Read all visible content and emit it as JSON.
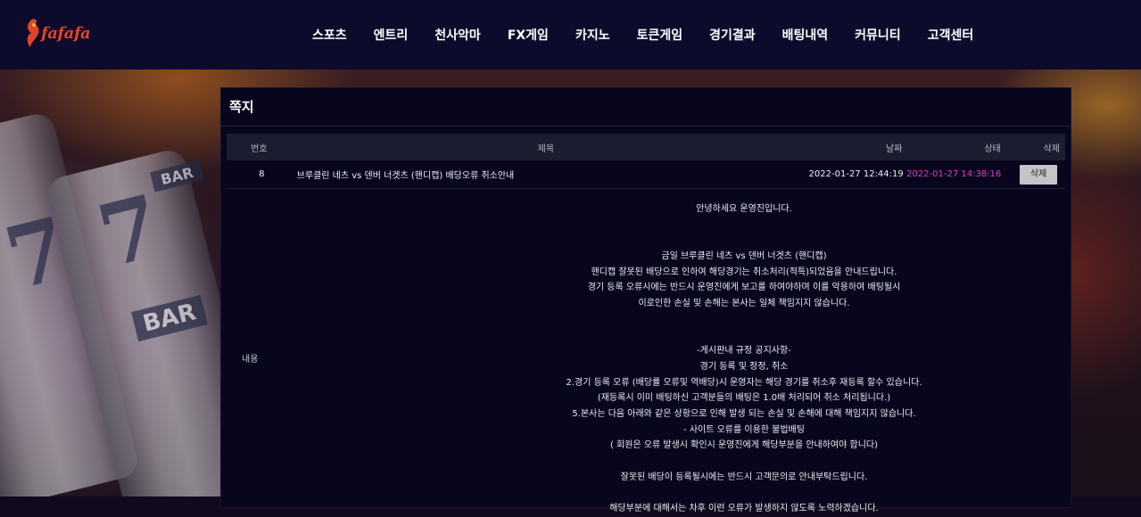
{
  "header": {
    "logo_text": "fafafa",
    "nav": [
      "스포츠",
      "엔트리",
      "천사악마",
      "FX게임",
      "카지노",
      "토큰게임",
      "경기결과",
      "배팅내역",
      "커뮤니티",
      "고객센터"
    ]
  },
  "background": {
    "slot_labels": [
      "7",
      "7",
      "BAR",
      "BAR"
    ]
  },
  "panel": {
    "title": "쪽지",
    "columns": {
      "no": "번호",
      "title": "제목",
      "date": "날짜",
      "state": "상태",
      "delete": "삭제"
    },
    "message": {
      "no": "8",
      "title": "브루클린 네츠 vs 덴버 너겟츠 (핸디캡) 배당오류 취소안내",
      "date": "2022-01-27 12:44:19",
      "read_time": "2022-01-27 14:38:16",
      "delete_label": "삭제",
      "content_label": "내용",
      "lines": [
        "안녕하세요 운영진입니다.",
        "",
        "",
        "금일 브루클린 네츠 vs 덴버 너겟츠 (핸디캡)",
        "핸디캡 잘못된 배당으로 인하여 해당경기는 취소처리(적특)되었음을 안내드립니다.",
        "경기 등록 오류시에는 반드시 운영진에게 보고를 하여야하며 이를 악용하여 배팅될시",
        "이로인한 손실 및 손해는 본사는 일체 책임지지 않습니다.",
        "",
        "",
        "-게시판내 규정 공지사항-",
        "경기 등록 및 정정, 취소",
        "2.경기 등록 오류 (배당률 오류및 역배당)시 운영자는 해당 경기를 취소후 재등록 할수 있습니다.",
        "(재등록시 이미 배팅하신 고객분들의 배팅은 1.0배 처리되어 취소 처리됩니다.)",
        "5.본사는 다음 아래와 같은 상황으로 인해 발생 되는 손실 및 손해에 대해 책임지지 않습니다.",
        "- 사이트 오류를 이용한 불법배팅",
        "( 회원은 오류 발생시 확인시 운영진에게 해당부분을 안내하여야 합니다)",
        "",
        "잘못된 배당이 등록될시에는 반드시 고객문의로 안내부탁드립니다.",
        "",
        "해당부분에 대해서는 차후 이런 오류가 발생하지 않도록 노력하겠습니다."
      ]
    }
  },
  "colors": {
    "header_bg": "#0d0b2b",
    "panel_bg": "#07061d",
    "read_time": "#e040c8",
    "logo": "#e0442a"
  }
}
